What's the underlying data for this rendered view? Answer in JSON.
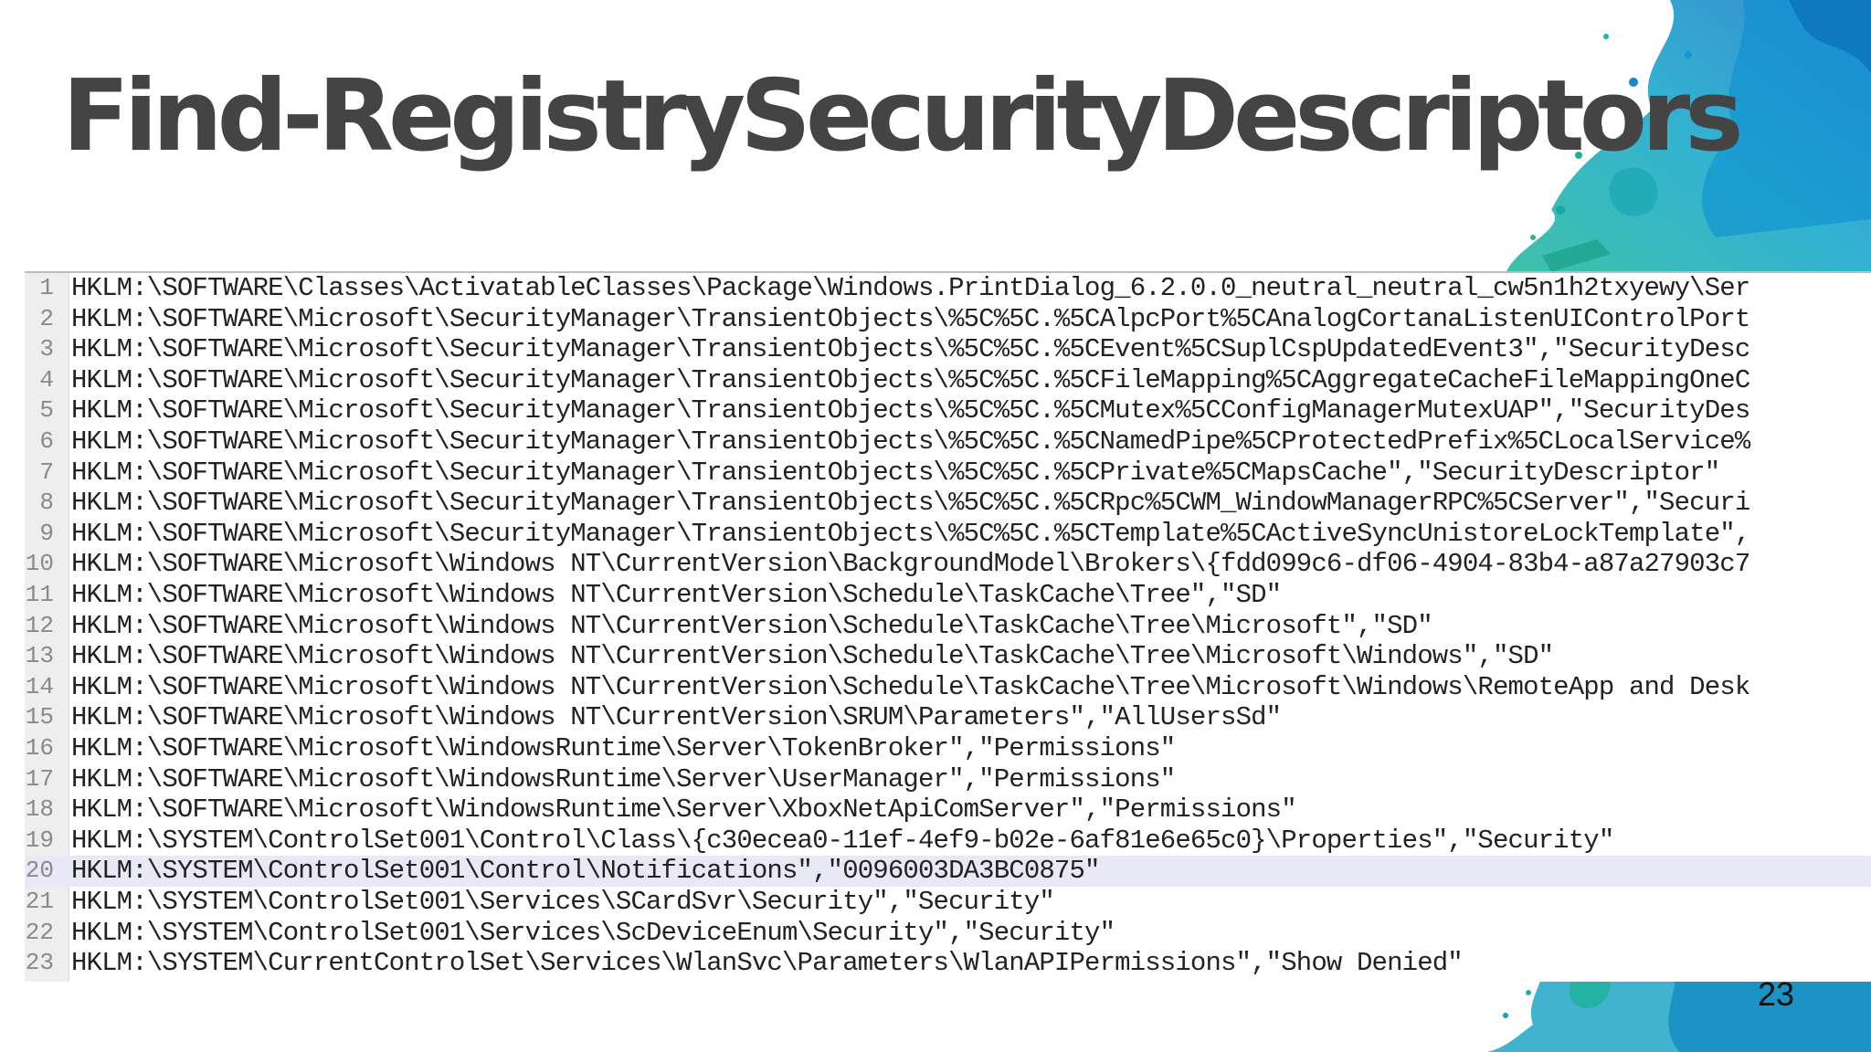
{
  "slide": {
    "title": "Find-RegistrySecurityDescriptors",
    "page_number": "23"
  },
  "editor": {
    "current_line": 20,
    "lines": [
      {
        "num": "1",
        "text": "HKLM:\\SOFTWARE\\Classes\\ActivatableClasses\\Package\\Windows.PrintDialog_6.2.0.0_neutral_neutral_cw5n1h2txyewy\\Ser"
      },
      {
        "num": "2",
        "text": "HKLM:\\SOFTWARE\\Microsoft\\SecurityManager\\TransientObjects\\%5C%5C.%5CAlpcPort%5CAnalogCortanaListenUIControlPort"
      },
      {
        "num": "3",
        "text": "HKLM:\\SOFTWARE\\Microsoft\\SecurityManager\\TransientObjects\\%5C%5C.%5CEvent%5CSuplCspUpdatedEvent3\",\"SecurityDesc"
      },
      {
        "num": "4",
        "text": "HKLM:\\SOFTWARE\\Microsoft\\SecurityManager\\TransientObjects\\%5C%5C.%5CFileMapping%5CAggregateCacheFileMappingOneC"
      },
      {
        "num": "5",
        "text": "HKLM:\\SOFTWARE\\Microsoft\\SecurityManager\\TransientObjects\\%5C%5C.%5CMutex%5CConfigManagerMutexUAP\",\"SecurityDes"
      },
      {
        "num": "6",
        "text": "HKLM:\\SOFTWARE\\Microsoft\\SecurityManager\\TransientObjects\\%5C%5C.%5CNamedPipe%5CProtectedPrefix%5CLocalService%"
      },
      {
        "num": "7",
        "text": "HKLM:\\SOFTWARE\\Microsoft\\SecurityManager\\TransientObjects\\%5C%5C.%5CPrivate%5CMapsCache\",\"SecurityDescriptor\""
      },
      {
        "num": "8",
        "text": "HKLM:\\SOFTWARE\\Microsoft\\SecurityManager\\TransientObjects\\%5C%5C.%5CRpc%5CWM_WindowManagerRPC%5CServer\",\"Securi"
      },
      {
        "num": "9",
        "text": "HKLM:\\SOFTWARE\\Microsoft\\SecurityManager\\TransientObjects\\%5C%5C.%5CTemplate%5CActiveSyncUnistoreLockTemplate\","
      },
      {
        "num": "10",
        "text": "HKLM:\\SOFTWARE\\Microsoft\\Windows NT\\CurrentVersion\\BackgroundModel\\Brokers\\{fdd099c6-df06-4904-83b4-a87a27903c7"
      },
      {
        "num": "11",
        "text": "HKLM:\\SOFTWARE\\Microsoft\\Windows NT\\CurrentVersion\\Schedule\\TaskCache\\Tree\",\"SD\""
      },
      {
        "num": "12",
        "text": "HKLM:\\SOFTWARE\\Microsoft\\Windows NT\\CurrentVersion\\Schedule\\TaskCache\\Tree\\Microsoft\",\"SD\""
      },
      {
        "num": "13",
        "text": "HKLM:\\SOFTWARE\\Microsoft\\Windows NT\\CurrentVersion\\Schedule\\TaskCache\\Tree\\Microsoft\\Windows\",\"SD\""
      },
      {
        "num": "14",
        "text": "HKLM:\\SOFTWARE\\Microsoft\\Windows NT\\CurrentVersion\\Schedule\\TaskCache\\Tree\\Microsoft\\Windows\\RemoteApp and Desk"
      },
      {
        "num": "15",
        "text": "HKLM:\\SOFTWARE\\Microsoft\\Windows NT\\CurrentVersion\\SRUM\\Parameters\",\"AllUsersSd\""
      },
      {
        "num": "16",
        "text": "HKLM:\\SOFTWARE\\Microsoft\\WindowsRuntime\\Server\\TokenBroker\",\"Permissions\""
      },
      {
        "num": "17",
        "text": "HKLM:\\SOFTWARE\\Microsoft\\WindowsRuntime\\Server\\UserManager\",\"Permissions\""
      },
      {
        "num": "18",
        "text": "HKLM:\\SOFTWARE\\Microsoft\\WindowsRuntime\\Server\\XboxNetApiComServer\",\"Permissions\""
      },
      {
        "num": "19",
        "text": "HKLM:\\SYSTEM\\ControlSet001\\Control\\Class\\{c30ecea0-11ef-4ef9-b02e-6af81e6e65c0}\\Properties\",\"Security\""
      },
      {
        "num": "20",
        "text": "HKLM:\\SYSTEM\\ControlSet001\\Control\\Notifications\",\"0096003DA3BC0875\""
      },
      {
        "num": "21",
        "text": "HKLM:\\SYSTEM\\ControlSet001\\Services\\SCardSvr\\Security\",\"Security\""
      },
      {
        "num": "22",
        "text": "HKLM:\\SYSTEM\\ControlSet001\\Services\\ScDeviceEnum\\Security\",\"Security\""
      },
      {
        "num": "23",
        "text": "HKLM:\\SYSTEM\\CurrentControlSet\\Services\\WlanSvc\\Parameters\\WlanAPIPermissions\",\"Show Denied\""
      }
    ]
  }
}
